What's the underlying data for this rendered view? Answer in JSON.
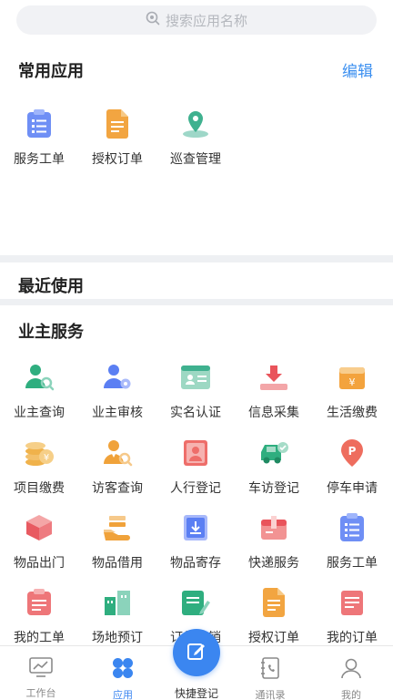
{
  "search": {
    "placeholder": "搜索应用名称",
    "icon": "search-icon"
  },
  "frequent": {
    "title": "常用应用",
    "edit_label": "编辑",
    "apps": [
      {
        "label": "服务工单",
        "icon": "service-ticket-icon"
      },
      {
        "label": "授权订单",
        "icon": "authorized-order-icon"
      },
      {
        "label": "巡查管理",
        "icon": "patrol-icon"
      }
    ]
  },
  "recent": {
    "title": "最近使用"
  },
  "owner_services": {
    "title": "业主服务",
    "apps": [
      {
        "label": "业主查询",
        "icon": "owner-search-icon"
      },
      {
        "label": "业主审核",
        "icon": "owner-review-icon"
      },
      {
        "label": "实名认证",
        "icon": "id-card-icon"
      },
      {
        "label": "信息采集",
        "icon": "info-collect-icon"
      },
      {
        "label": "生活缴费",
        "icon": "living-payment-icon"
      },
      {
        "label": "项目缴费",
        "icon": "project-payment-icon"
      },
      {
        "label": "访客查询",
        "icon": "visitor-search-icon"
      },
      {
        "label": "人行登记",
        "icon": "pedestrian-register-icon"
      },
      {
        "label": "车访登记",
        "icon": "car-visit-icon"
      },
      {
        "label": "停车申请",
        "icon": "parking-icon"
      },
      {
        "label": "物品出门",
        "icon": "item-out-icon"
      },
      {
        "label": "物品借用",
        "icon": "item-borrow-icon"
      },
      {
        "label": "物品寄存",
        "icon": "item-storage-icon"
      },
      {
        "label": "快递服务",
        "icon": "express-icon"
      },
      {
        "label": "服务工单",
        "icon": "service-ticket-icon"
      },
      {
        "label": "我的工单",
        "icon": "my-ticket-icon"
      },
      {
        "label": "场地预订",
        "icon": "venue-booking-icon"
      },
      {
        "label": "订单核销",
        "icon": "order-verify-icon"
      },
      {
        "label": "授权订单",
        "icon": "authorized-order-icon"
      },
      {
        "label": "我的订单",
        "icon": "my-order-icon"
      }
    ]
  },
  "tabbar": {
    "tabs": [
      {
        "label": "工作台",
        "icon": "workbench-icon"
      },
      {
        "label": "应用",
        "icon": "apps-icon"
      },
      {
        "label": "快捷登记",
        "icon": "quick-register-icon"
      },
      {
        "label": "通讯录",
        "icon": "contacts-icon"
      },
      {
        "label": "我的",
        "icon": "profile-icon"
      }
    ],
    "active": "应用"
  },
  "colors": {
    "accent": "#3b86f0",
    "edit": "#3b8ff0"
  }
}
